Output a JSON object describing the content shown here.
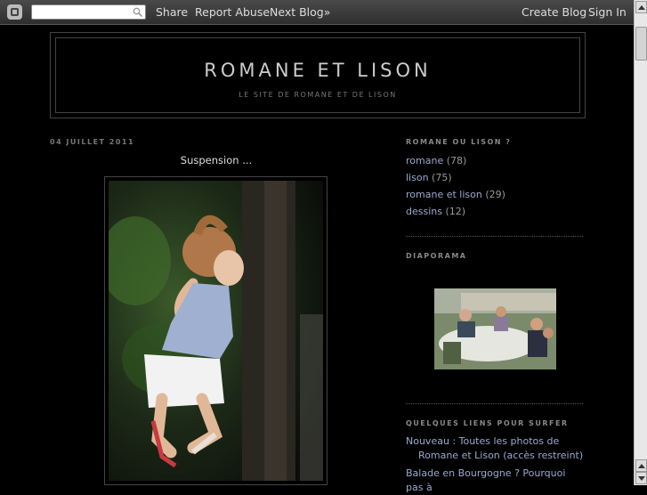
{
  "navbar": {
    "share": "Share",
    "report": "Report Abuse",
    "next": "Next Blog»",
    "create": "Create Blog",
    "signin": "Sign In"
  },
  "header": {
    "title": "ROMANE ET LISON",
    "description": "LE SITE DE ROMANE ET DE LISON"
  },
  "post": {
    "date": "04 JUILLET 2011",
    "title": "Suspension ..."
  },
  "sidebar": {
    "labels_heading": "ROMANE OU LISON ?",
    "labels": [
      {
        "name": "romane",
        "count": "(78)"
      },
      {
        "name": "lison",
        "count": "(75)"
      },
      {
        "name": "romane et lison",
        "count": "(29)"
      },
      {
        "name": "dessins",
        "count": "(12)"
      }
    ],
    "slideshow_heading": "DIAPORAMA",
    "links_heading": "QUELQUES LIENS POUR SURFER",
    "links": [
      {
        "text": "Nouveau : Toutes les photos de Romane et Lison (accès restreint)"
      },
      {
        "text": "Balade en Bourgogne ? Pourquoi pas à"
      }
    ]
  },
  "colors": {
    "background": "#000000",
    "link": "#99aacc",
    "navbar": "#3a3a3a"
  }
}
